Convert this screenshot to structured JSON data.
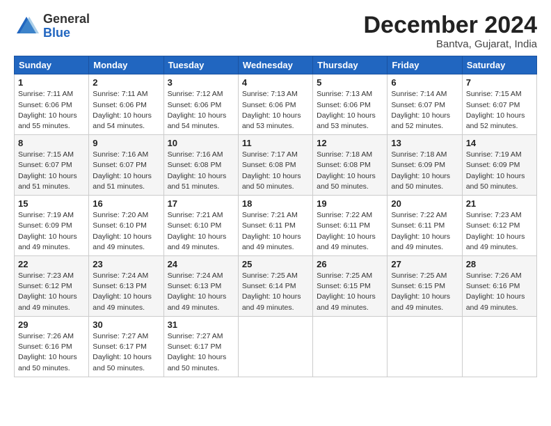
{
  "logo": {
    "general": "General",
    "blue": "Blue"
  },
  "header": {
    "month": "December 2024",
    "location": "Bantva, Gujarat, India"
  },
  "weekdays": [
    "Sunday",
    "Monday",
    "Tuesday",
    "Wednesday",
    "Thursday",
    "Friday",
    "Saturday"
  ],
  "weeks": [
    [
      {
        "day": "1",
        "sunrise": "7:11 AM",
        "sunset": "6:06 PM",
        "daylight": "10 hours and 55 minutes."
      },
      {
        "day": "2",
        "sunrise": "7:11 AM",
        "sunset": "6:06 PM",
        "daylight": "10 hours and 54 minutes."
      },
      {
        "day": "3",
        "sunrise": "7:12 AM",
        "sunset": "6:06 PM",
        "daylight": "10 hours and 54 minutes."
      },
      {
        "day": "4",
        "sunrise": "7:13 AM",
        "sunset": "6:06 PM",
        "daylight": "10 hours and 53 minutes."
      },
      {
        "day": "5",
        "sunrise": "7:13 AM",
        "sunset": "6:06 PM",
        "daylight": "10 hours and 53 minutes."
      },
      {
        "day": "6",
        "sunrise": "7:14 AM",
        "sunset": "6:07 PM",
        "daylight": "10 hours and 52 minutes."
      },
      {
        "day": "7",
        "sunrise": "7:15 AM",
        "sunset": "6:07 PM",
        "daylight": "10 hours and 52 minutes."
      }
    ],
    [
      {
        "day": "8",
        "sunrise": "7:15 AM",
        "sunset": "6:07 PM",
        "daylight": "10 hours and 51 minutes."
      },
      {
        "day": "9",
        "sunrise": "7:16 AM",
        "sunset": "6:07 PM",
        "daylight": "10 hours and 51 minutes."
      },
      {
        "day": "10",
        "sunrise": "7:16 AM",
        "sunset": "6:08 PM",
        "daylight": "10 hours and 51 minutes."
      },
      {
        "day": "11",
        "sunrise": "7:17 AM",
        "sunset": "6:08 PM",
        "daylight": "10 hours and 50 minutes."
      },
      {
        "day": "12",
        "sunrise": "7:18 AM",
        "sunset": "6:08 PM",
        "daylight": "10 hours and 50 minutes."
      },
      {
        "day": "13",
        "sunrise": "7:18 AM",
        "sunset": "6:09 PM",
        "daylight": "10 hours and 50 minutes."
      },
      {
        "day": "14",
        "sunrise": "7:19 AM",
        "sunset": "6:09 PM",
        "daylight": "10 hours and 50 minutes."
      }
    ],
    [
      {
        "day": "15",
        "sunrise": "7:19 AM",
        "sunset": "6:09 PM",
        "daylight": "10 hours and 49 minutes."
      },
      {
        "day": "16",
        "sunrise": "7:20 AM",
        "sunset": "6:10 PM",
        "daylight": "10 hours and 49 minutes."
      },
      {
        "day": "17",
        "sunrise": "7:21 AM",
        "sunset": "6:10 PM",
        "daylight": "10 hours and 49 minutes."
      },
      {
        "day": "18",
        "sunrise": "7:21 AM",
        "sunset": "6:11 PM",
        "daylight": "10 hours and 49 minutes."
      },
      {
        "day": "19",
        "sunrise": "7:22 AM",
        "sunset": "6:11 PM",
        "daylight": "10 hours and 49 minutes."
      },
      {
        "day": "20",
        "sunrise": "7:22 AM",
        "sunset": "6:11 PM",
        "daylight": "10 hours and 49 minutes."
      },
      {
        "day": "21",
        "sunrise": "7:23 AM",
        "sunset": "6:12 PM",
        "daylight": "10 hours and 49 minutes."
      }
    ],
    [
      {
        "day": "22",
        "sunrise": "7:23 AM",
        "sunset": "6:12 PM",
        "daylight": "10 hours and 49 minutes."
      },
      {
        "day": "23",
        "sunrise": "7:24 AM",
        "sunset": "6:13 PM",
        "daylight": "10 hours and 49 minutes."
      },
      {
        "day": "24",
        "sunrise": "7:24 AM",
        "sunset": "6:13 PM",
        "daylight": "10 hours and 49 minutes."
      },
      {
        "day": "25",
        "sunrise": "7:25 AM",
        "sunset": "6:14 PM",
        "daylight": "10 hours and 49 minutes."
      },
      {
        "day": "26",
        "sunrise": "7:25 AM",
        "sunset": "6:15 PM",
        "daylight": "10 hours and 49 minutes."
      },
      {
        "day": "27",
        "sunrise": "7:25 AM",
        "sunset": "6:15 PM",
        "daylight": "10 hours and 49 minutes."
      },
      {
        "day": "28",
        "sunrise": "7:26 AM",
        "sunset": "6:16 PM",
        "daylight": "10 hours and 49 minutes."
      }
    ],
    [
      {
        "day": "29",
        "sunrise": "7:26 AM",
        "sunset": "6:16 PM",
        "daylight": "10 hours and 50 minutes."
      },
      {
        "day": "30",
        "sunrise": "7:27 AM",
        "sunset": "6:17 PM",
        "daylight": "10 hours and 50 minutes."
      },
      {
        "day": "31",
        "sunrise": "7:27 AM",
        "sunset": "6:17 PM",
        "daylight": "10 hours and 50 minutes."
      },
      null,
      null,
      null,
      null
    ]
  ]
}
